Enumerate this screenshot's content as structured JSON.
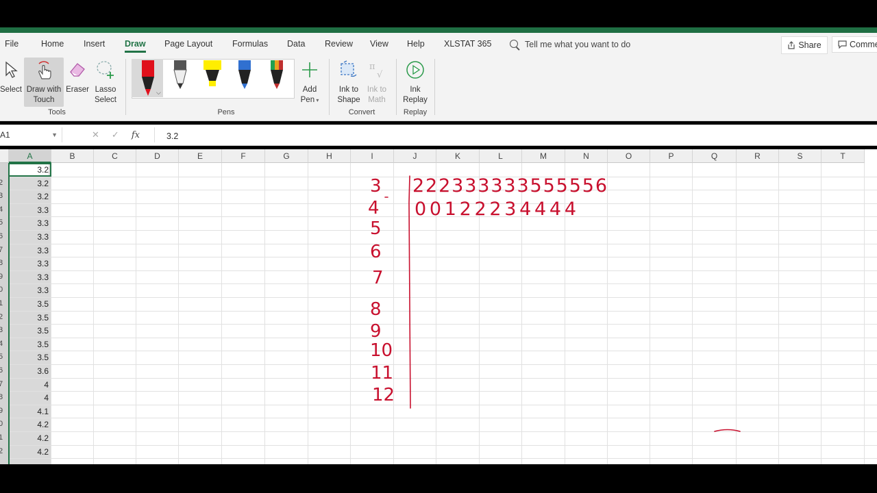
{
  "ribbon_tabs": [
    "File",
    "Home",
    "Insert",
    "Draw",
    "Page Layout",
    "Formulas",
    "Data",
    "Review",
    "View",
    "Help",
    "XLSTAT 365"
  ],
  "active_tab": "Draw",
  "tell_me": "Tell me what you want to do",
  "share_label": "Share",
  "comments_label": "Comme",
  "ribbon": {
    "select": "Select",
    "draw_with_touch_1": "Draw with",
    "draw_with_touch_2": "Touch",
    "eraser": "Eraser",
    "lasso_1": "Lasso",
    "lasso_2": "Select",
    "tools_group": "Tools",
    "pens_group": "Pens",
    "add_pen_1": "Add",
    "add_pen_2": "Pen",
    "ink_to_shape_1": "Ink to",
    "ink_to_shape_2": "Shape",
    "ink_to_math_1": "Ink to",
    "ink_to_math_2": "Math",
    "convert_group": "Convert",
    "ink_replay_1": "Ink",
    "ink_replay_2": "Replay",
    "replay_group": "Replay"
  },
  "pen_colors": [
    "#e0101c",
    "#404040",
    "#ffee00",
    "#3070d0",
    "#20a050"
  ],
  "formula_bar": {
    "name_box": "A1",
    "cancel": "✕",
    "enter": "✓",
    "fx": "fx",
    "value": "3.2"
  },
  "columns": [
    "A",
    "B",
    "C",
    "D",
    "E",
    "F",
    "G",
    "H",
    "I",
    "J",
    "K",
    "L",
    "M",
    "N",
    "O",
    "P",
    "Q",
    "R",
    "S",
    "T"
  ],
  "row_numbers": [
    "",
    "2",
    "3",
    "4",
    "5",
    "6",
    "7",
    "8",
    "9",
    "0",
    "1",
    "2",
    "3",
    "4",
    "5",
    "6",
    "7",
    "8",
    "9",
    "0",
    "1",
    "2"
  ],
  "column_a_values": [
    "3.2",
    "3.2",
    "3.2",
    "3.3",
    "3.3",
    "3.3",
    "3.3",
    "3.3",
    "3.3",
    "3.3",
    "3.5",
    "3.5",
    "3.5",
    "3.5",
    "3.5",
    "3.6",
    "4",
    "4",
    "4.1",
    "4.2",
    "4.2",
    "4.2"
  ],
  "ink": {
    "color": "#c8102e",
    "stems": [
      "3",
      "4",
      "5",
      "6",
      "7",
      "8",
      "9",
      "10",
      "11",
      "12"
    ],
    "leaves_row_3": "222333333555556",
    "leaves_row_4": "00122234444"
  }
}
